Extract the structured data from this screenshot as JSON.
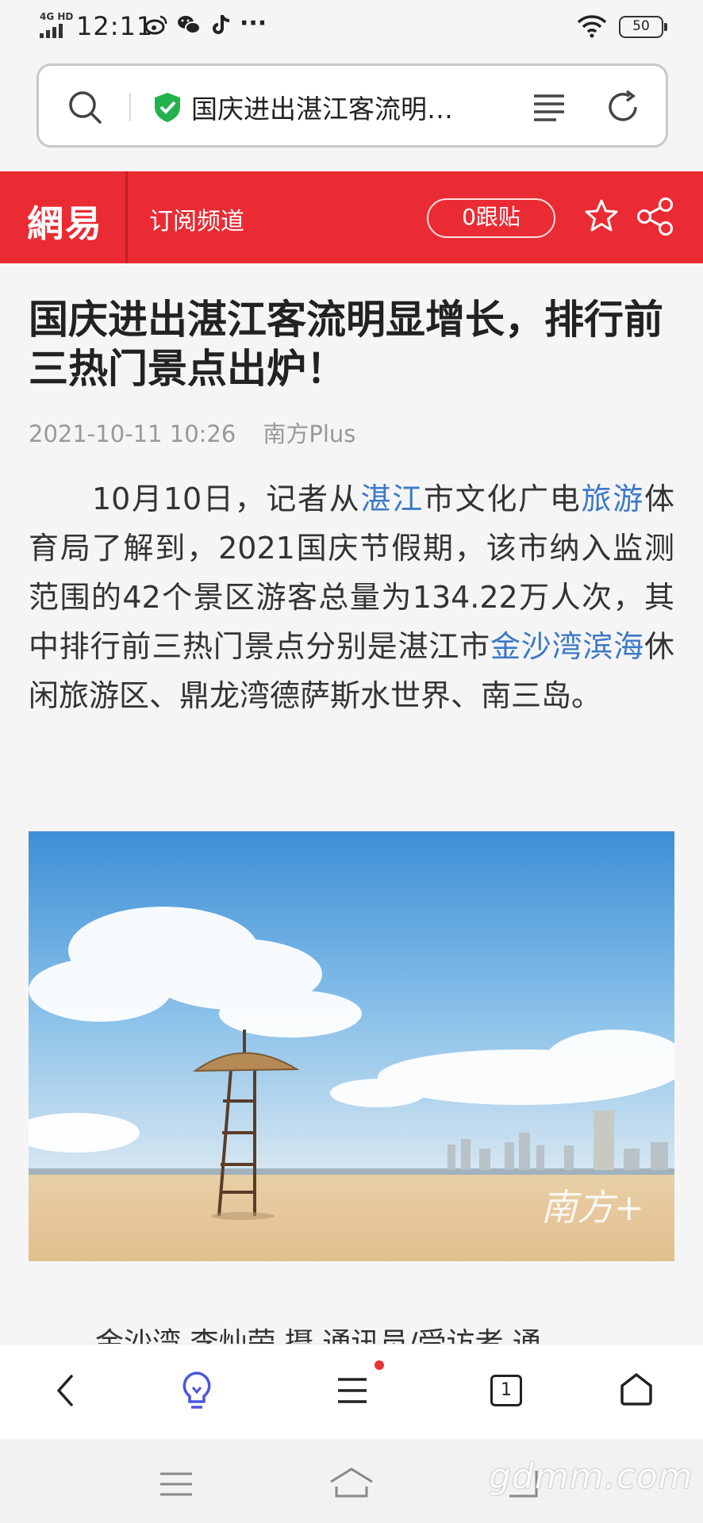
{
  "status_bar": {
    "network": "4G HD",
    "time": "12:11",
    "more": "···",
    "battery": "50",
    "icons": [
      "weibo-icon",
      "wechat-icon",
      "tiktok-icon",
      "wifi-icon",
      "battery-icon"
    ]
  },
  "url_bar": {
    "text": "国庆进出湛江客流明…"
  },
  "site_header": {
    "logo": "網易",
    "subscribe": "订阅频道",
    "follow_count": "0跟贴",
    "brand_color": "#ea2b33"
  },
  "article": {
    "title": "国庆进出湛江客流明显增长，排行前三热门景点出炉！",
    "date": "2021-10-11 10:26",
    "source": "南方Plus",
    "para": {
      "p1": "10月10日，记者从",
      "link1": "湛江",
      "p2": "市文化广电",
      "link2": "旅游",
      "p3": "体育局了解到，2021国庆节假期，该市纳入监测范围的42个景区游客总量为134.22万人次，其中排行前三热门景点分别是湛江市",
      "link3": "金沙湾滨海",
      "p4": "休闲旅游区、鼎龙湾德萨斯水世界、南三岛。"
    },
    "image_watermark": "南方+",
    "caption_partial": "金沙湾    李灿荣 摄  通讯员/受访者 通"
  },
  "toolbar": {
    "tab_count": "1",
    "icons": [
      "back-icon",
      "bulb-icon",
      "menu-icon",
      "tabs-icon",
      "home-icon"
    ]
  },
  "watermark": "gdmm.com"
}
